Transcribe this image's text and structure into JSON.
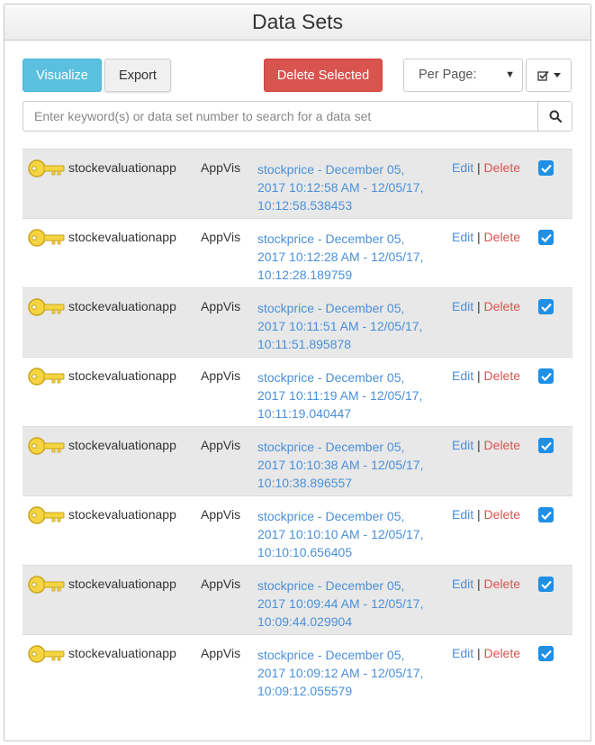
{
  "header": {
    "title": "Data Sets"
  },
  "toolbar": {
    "visualize_label": "Visualize",
    "export_label": "Export",
    "delete_selected_label": "Delete Selected",
    "per_page_label": "Per Page:"
  },
  "search": {
    "placeholder": "Enter keyword(s) or data set number to search for a data set"
  },
  "rows": [
    {
      "app": "stockevaluationapp",
      "source": "AppVis",
      "dataset": "stockprice - December 05,\n2017 10:12:58 AM - 12/05/17,\n10:12:58.538453",
      "edit": "Edit",
      "sep": "|",
      "delete": "Delete",
      "checked": true
    },
    {
      "app": "stockevaluationapp",
      "source": "AppVis",
      "dataset": "stockprice - December 05,\n2017 10:12:28 AM - 12/05/17,\n10:12:28.189759",
      "edit": "Edit",
      "sep": "|",
      "delete": "Delete",
      "checked": true
    },
    {
      "app": "stockevaluationapp",
      "source": "AppVis",
      "dataset": "stockprice - December 05,\n2017 10:11:51 AM - 12/05/17,\n10:11:51.895878",
      "edit": "Edit",
      "sep": "|",
      "delete": "Delete",
      "checked": true
    },
    {
      "app": "stockevaluationapp",
      "source": "AppVis",
      "dataset": "stockprice - December 05,\n2017 10:11:19 AM - 12/05/17,\n10:11:19.040447",
      "edit": "Edit",
      "sep": "|",
      "delete": "Delete",
      "checked": true
    },
    {
      "app": "stockevaluationapp",
      "source": "AppVis",
      "dataset": "stockprice - December 05,\n2017 10:10:38 AM - 12/05/17,\n10:10:38.896557",
      "edit": "Edit",
      "sep": "|",
      "delete": "Delete",
      "checked": true
    },
    {
      "app": "stockevaluationapp",
      "source": "AppVis",
      "dataset": "stockprice - December 05,\n2017 10:10:10 AM - 12/05/17,\n10:10:10.656405",
      "edit": "Edit",
      "sep": "|",
      "delete": "Delete",
      "checked": true
    },
    {
      "app": "stockevaluationapp",
      "source": "AppVis",
      "dataset": "stockprice - December 05,\n2017 10:09:44 AM - 12/05/17,\n10:09:44.029904",
      "edit": "Edit",
      "sep": "|",
      "delete": "Delete",
      "checked": true
    },
    {
      "app": "stockevaluationapp",
      "source": "AppVis",
      "dataset": "stockprice - December 05,\n2017 10:09:12 AM - 12/05/17,\n10:09:12.055579",
      "edit": "Edit",
      "sep": "|",
      "delete": "Delete",
      "checked": true
    }
  ],
  "icons": {
    "key": "key-icon",
    "search": "search-icon",
    "column_toggle": "checkbox-list-icon",
    "dropdown": "chevron-down-icon"
  },
  "colors": {
    "visualize": "#5bc0de",
    "delete": "#d9534f",
    "link": "#4a90d9",
    "checkbox": "#1e90e6",
    "stripe": "#e8e8e8"
  }
}
